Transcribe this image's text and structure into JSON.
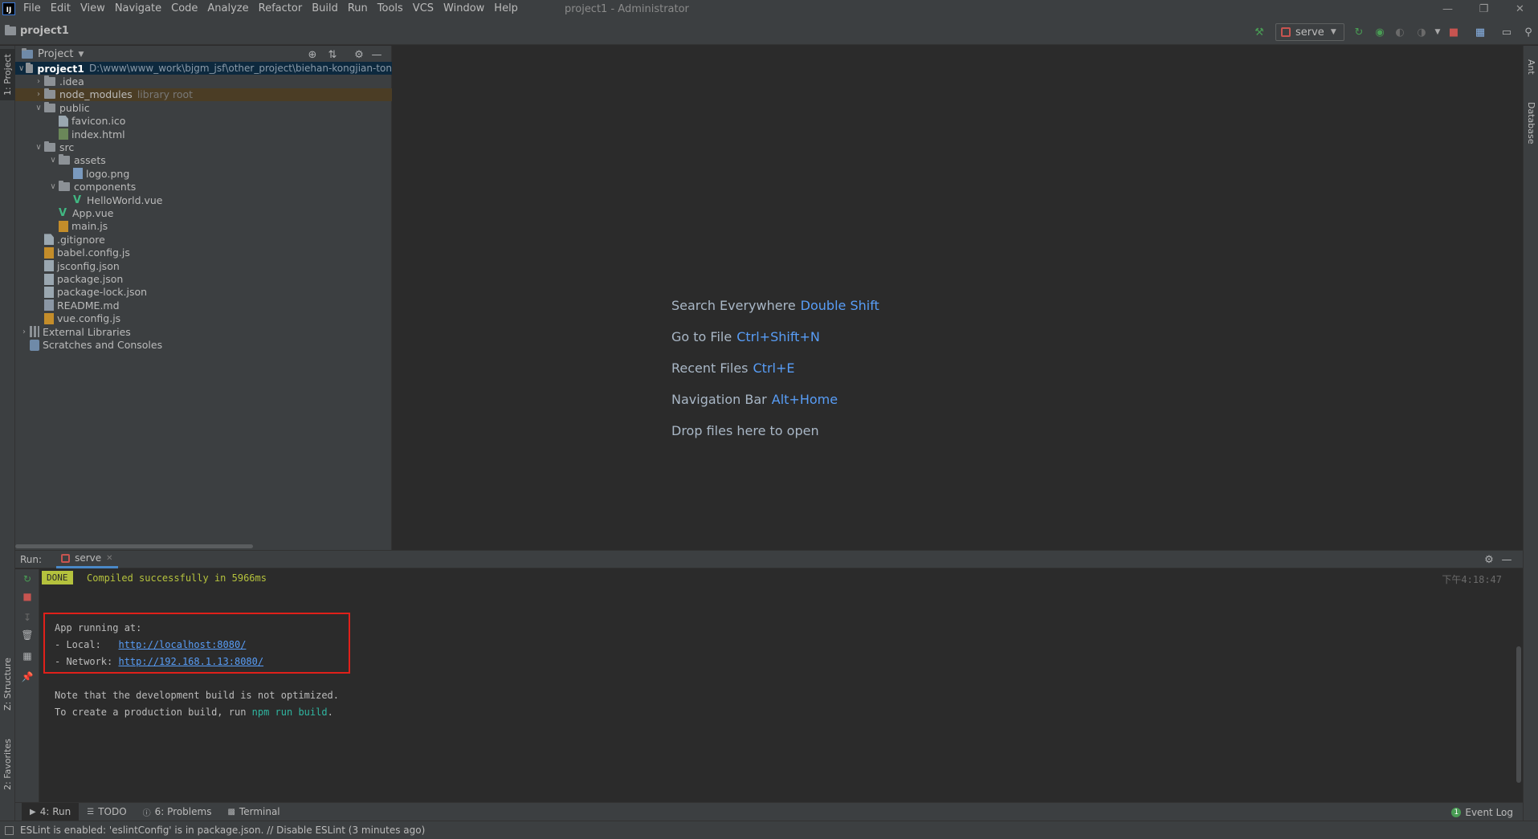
{
  "window": {
    "title": "project1 - Administrator",
    "logo_text": "IJ"
  },
  "menu": [
    "File",
    "Edit",
    "View",
    "Navigate",
    "Code",
    "Analyze",
    "Refactor",
    "Build",
    "Run",
    "Tools",
    "VCS",
    "Window",
    "Help"
  ],
  "navbar": {
    "project_name": "project1",
    "run_config": "serve"
  },
  "left_stripe": {
    "project_tab": "1: Project",
    "structure_tab": "Z: Structure",
    "favorites_tab": "2: Favorites"
  },
  "right_stripe": {
    "ant_tab": "Ant",
    "database_tab": "Database"
  },
  "project_panel": {
    "title": "Project",
    "tree": [
      {
        "label": "project1",
        "extra": "D:\\www\\www_work\\bjgm_jsf\\other_project\\biehan-kongjian-ton",
        "indent": 0,
        "type": "project",
        "expanded": true
      },
      {
        "label": ".idea",
        "indent": 1,
        "type": "folder",
        "expanded": false
      },
      {
        "label": "node_modules",
        "extra": "library root",
        "indent": 1,
        "type": "folder-lib",
        "expanded": false
      },
      {
        "label": "public",
        "indent": 1,
        "type": "folder",
        "expanded": true
      },
      {
        "label": "favicon.ico",
        "indent": 2,
        "type": "file-gen"
      },
      {
        "label": "index.html",
        "indent": 2,
        "type": "file-html"
      },
      {
        "label": "src",
        "indent": 1,
        "type": "folder",
        "expanded": true
      },
      {
        "label": "assets",
        "indent": 2,
        "type": "folder",
        "expanded": true
      },
      {
        "label": "logo.png",
        "indent": 3,
        "type": "file-png"
      },
      {
        "label": "components",
        "indent": 2,
        "type": "folder",
        "expanded": true
      },
      {
        "label": "HelloWorld.vue",
        "indent": 3,
        "type": "file-vue"
      },
      {
        "label": "App.vue",
        "indent": 2,
        "type": "file-vue"
      },
      {
        "label": "main.js",
        "indent": 2,
        "type": "file-js"
      },
      {
        "label": ".gitignore",
        "indent": 1,
        "type": "file-gen"
      },
      {
        "label": "babel.config.js",
        "indent": 1,
        "type": "file-js"
      },
      {
        "label": "jsconfig.json",
        "indent": 1,
        "type": "file-json"
      },
      {
        "label": "package.json",
        "indent": 1,
        "type": "file-json"
      },
      {
        "label": "package-lock.json",
        "indent": 1,
        "type": "file-json"
      },
      {
        "label": "README.md",
        "indent": 1,
        "type": "file-md"
      },
      {
        "label": "vue.config.js",
        "indent": 1,
        "type": "file-js"
      },
      {
        "label": "External Libraries",
        "indent": 0,
        "type": "libs",
        "expanded": false
      },
      {
        "label": "Scratches and Consoles",
        "indent": 0,
        "type": "scratches"
      }
    ]
  },
  "editor": {
    "hints": [
      {
        "label": "Search Everywhere",
        "key": "Double Shift"
      },
      {
        "label": "Go to File",
        "key": "Ctrl+Shift+N"
      },
      {
        "label": "Recent Files",
        "key": "Ctrl+E"
      },
      {
        "label": "Navigation Bar",
        "key": "Alt+Home"
      },
      {
        "label": "Drop files here to open",
        "key": ""
      }
    ]
  },
  "run_window": {
    "label": "Run:",
    "tab": "serve",
    "done_badge": "DONE",
    "done_text": "Compiled successfully in 5966ms",
    "timestamp": "下午4:18:47",
    "app_running": "App running at:",
    "local_label": "- Local:   ",
    "local_url": "http://localhost:8080/",
    "network_label": "- Network: ",
    "network_url": "http://192.168.1.13:8080/",
    "note_line": "Note that the development build is not optimized.",
    "prod_prefix": "To create a production build, run ",
    "prod_cmd": "npm run build",
    "prod_suffix": "."
  },
  "bottom_tabs": {
    "run": "4: Run",
    "todo": "TODO",
    "problems": "6: Problems",
    "terminal": "Terminal",
    "event_log": "Event Log"
  },
  "status_bar": {
    "message": "ESLint is enabled: 'eslintConfig' is in package.json. // Disable ESLint (3 minutes ago)"
  },
  "colors": {
    "accent": "#589df6",
    "done": "#b5c23d",
    "highlight_box": "#e0201a",
    "vue": "#41b883"
  }
}
